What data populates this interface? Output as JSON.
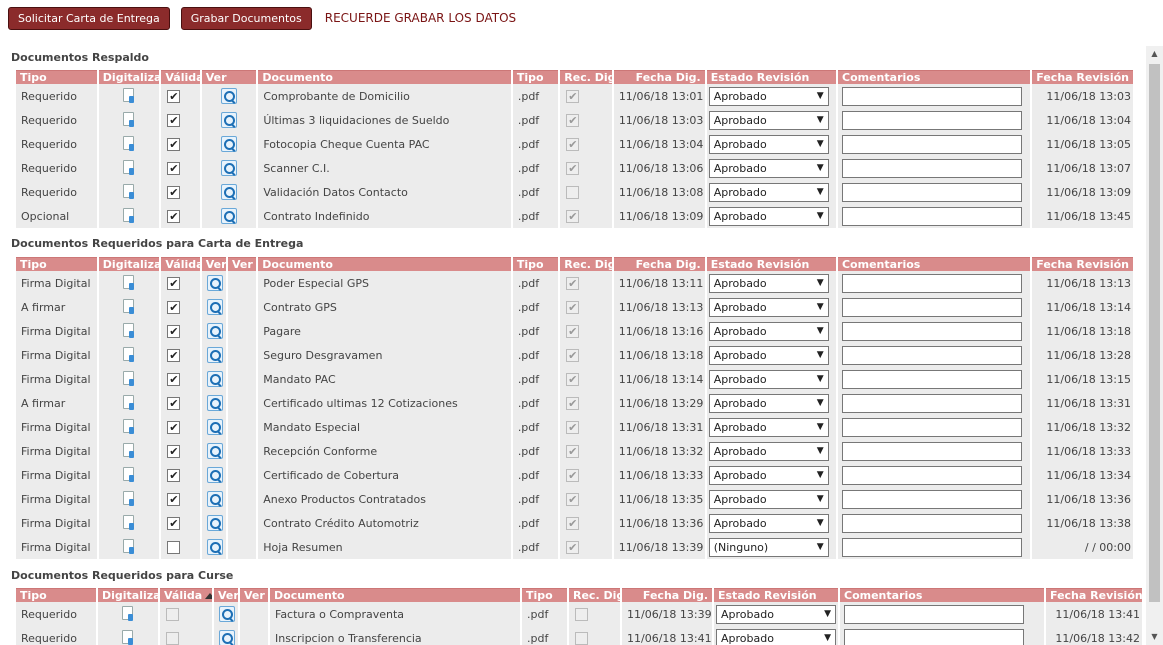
{
  "toolbar": {
    "btn_solicitar": "Solicitar Carta de Entrega",
    "btn_grabar": "Grabar Documentos",
    "notice": "RECUERDE GRABAR LOS DATOS"
  },
  "sections": [
    {
      "title": "Documentos Respaldo",
      "headers": {
        "tipo": "Tipo",
        "digitalizar": "Digitalizar",
        "valida": "Válida",
        "ver": "Ver",
        "documento": "Documento",
        "tipo2": "Tipo",
        "rec": "Rec. Dig.",
        "fecha": "Fecha Dig.",
        "estado": "Estado Revisión",
        "comentarios": "Comentarios",
        "fecha_rev": "Fecha Revisión"
      },
      "rows": [
        {
          "tipo": "Requerido",
          "documento": "Comprobante de Domicilio",
          "ext": ".pdf",
          "fecha": "11/06/18 13:01",
          "estado": "Aprobado",
          "fecha_rev": "11/06/18 13:03",
          "valida": true,
          "rec": true
        },
        {
          "tipo": "Requerido",
          "documento": "Últimas 3 liquidaciones de Sueldo",
          "ext": ".pdf",
          "fecha": "11/06/18 13:03",
          "estado": "Aprobado",
          "fecha_rev": "11/06/18 13:04",
          "valida": true,
          "rec": true
        },
        {
          "tipo": "Requerido",
          "documento": "Fotocopia Cheque Cuenta PAC",
          "ext": ".pdf",
          "fecha": "11/06/18 13:04",
          "estado": "Aprobado",
          "fecha_rev": "11/06/18 13:05",
          "valida": true,
          "rec": true
        },
        {
          "tipo": "Requerido",
          "documento": "Scanner C.I.",
          "ext": ".pdf",
          "fecha": "11/06/18 13:06",
          "estado": "Aprobado",
          "fecha_rev": "11/06/18 13:07",
          "valida": true,
          "rec": true
        },
        {
          "tipo": "Requerido",
          "documento": "Validación Datos Contacto",
          "ext": ".pdf",
          "fecha": "11/06/18 13:08",
          "estado": "Aprobado",
          "fecha_rev": "11/06/18 13:09",
          "valida": true,
          "rec": false
        },
        {
          "tipo": "Opcional",
          "documento": "Contrato Indefinido",
          "ext": ".pdf",
          "fecha": "11/06/18 13:09",
          "estado": "Aprobado",
          "fecha_rev": "11/06/18 13:45",
          "valida": true,
          "rec": true
        }
      ]
    },
    {
      "title": "Documentos Requeridos para Carta de Entrega",
      "headers": {
        "tipo": "Tipo",
        "digitalizar": "Digitalizar",
        "valida": "Válida",
        "ver": "Ver",
        "ver2": "Ver",
        "documento": "Documento",
        "tipo2": "Tipo",
        "rec": "Rec. Dig.",
        "fecha": "Fecha Dig.",
        "estado": "Estado Revisión",
        "comentarios": "Comentarios",
        "fecha_rev": "Fecha Revisión"
      },
      "rows": [
        {
          "tipo": "Firma Digital",
          "documento": "Poder Especial GPS",
          "ext": ".pdf",
          "fecha": "11/06/18 13:11",
          "estado": "Aprobado",
          "fecha_rev": "11/06/18 13:13",
          "valida": true,
          "rec": true
        },
        {
          "tipo": "A firmar",
          "documento": "Contrato GPS",
          "ext": ".pdf",
          "fecha": "11/06/18 13:13",
          "estado": "Aprobado",
          "fecha_rev": "11/06/18 13:14",
          "valida": true,
          "rec": true
        },
        {
          "tipo": "Firma Digital",
          "documento": "Pagare",
          "ext": ".pdf",
          "fecha": "11/06/18 13:16",
          "estado": "Aprobado",
          "fecha_rev": "11/06/18 13:18",
          "valida": true,
          "rec": true
        },
        {
          "tipo": "Firma Digital",
          "documento": "Seguro Desgravamen",
          "ext": ".pdf",
          "fecha": "11/06/18 13:18",
          "estado": "Aprobado",
          "fecha_rev": "11/06/18 13:28",
          "valida": true,
          "rec": true
        },
        {
          "tipo": "Firma Digital",
          "documento": "Mandato PAC",
          "ext": ".pdf",
          "fecha": "11/06/18 13:14",
          "estado": "Aprobado",
          "fecha_rev": "11/06/18 13:15",
          "valida": true,
          "rec": true
        },
        {
          "tipo": "A firmar",
          "documento": "Certificado ultimas 12 Cotizaciones",
          "ext": ".pdf",
          "fecha": "11/06/18 13:29",
          "estado": "Aprobado",
          "fecha_rev": "11/06/18 13:31",
          "valida": true,
          "rec": true
        },
        {
          "tipo": "Firma Digital",
          "documento": "Mandato Especial",
          "ext": ".pdf",
          "fecha": "11/06/18 13:31",
          "estado": "Aprobado",
          "fecha_rev": "11/06/18 13:32",
          "valida": true,
          "rec": true
        },
        {
          "tipo": "Firma Digital",
          "documento": "Recepción Conforme",
          "ext": ".pdf",
          "fecha": "11/06/18 13:32",
          "estado": "Aprobado",
          "fecha_rev": "11/06/18 13:33",
          "valida": true,
          "rec": true
        },
        {
          "tipo": "Firma Digital",
          "documento": "Certificado de Cobertura",
          "ext": ".pdf",
          "fecha": "11/06/18 13:33",
          "estado": "Aprobado",
          "fecha_rev": "11/06/18 13:34",
          "valida": true,
          "rec": true
        },
        {
          "tipo": "Firma Digital",
          "documento": "Anexo Productos Contratados",
          "ext": ".pdf",
          "fecha": "11/06/18 13:35",
          "estado": "Aprobado",
          "fecha_rev": "11/06/18 13:36",
          "valida": true,
          "rec": true
        },
        {
          "tipo": "Firma Digital",
          "documento": "Contrato Crédito Automotriz",
          "ext": ".pdf",
          "fecha": "11/06/18 13:36",
          "estado": "Aprobado",
          "fecha_rev": "11/06/18 13:38",
          "valida": true,
          "rec": true
        },
        {
          "tipo": "Firma Digital",
          "documento": "Hoja Resumen",
          "ext": ".pdf",
          "fecha": "11/06/18 13:39",
          "estado": "(Ninguno)",
          "fecha_rev": "/ / 00:00",
          "valida": false,
          "rec": true
        }
      ]
    },
    {
      "title": "Documentos Requeridos para Curse",
      "headers": {
        "tipo": "Tipo",
        "digitalizar": "Digitalizar",
        "valida": "Válida",
        "ver": "Ver",
        "ver2": "Ver",
        "documento": "Documento",
        "tipo2": "Tipo",
        "rec": "Rec. Dig.",
        "fecha": "Fecha Dig.",
        "estado": "Estado Revisión",
        "comentarios": "Comentarios",
        "fecha_rev": "Fecha Revisión"
      },
      "rows": [
        {
          "tipo": "Requerido",
          "documento": "Factura o Compraventa",
          "ext": ".pdf",
          "fecha": "11/06/18 13:39",
          "estado": "Aprobado",
          "fecha_rev": "11/06/18 13:41",
          "valida": false,
          "rec": false
        },
        {
          "tipo": "Requerido",
          "documento": "Inscripcion o Transferencia",
          "ext": ".pdf",
          "fecha": "11/06/18 13:41",
          "estado": "Aprobado",
          "fecha_rev": "11/06/18 13:42",
          "valida": false,
          "rec": false
        }
      ]
    }
  ],
  "icons": {
    "digitalizar": "document-upload-icon",
    "ver": "magnifier-icon",
    "check_mark": "✔",
    "dropdown_arrow": "▼",
    "sort": "sort-ascending-icon",
    "scroll_up": "▲",
    "scroll_down": "▼"
  },
  "colors": {
    "button_bg": "#8b2b2b",
    "notice": "#7a1414",
    "header_bg": "#d98b8b",
    "row_bg": "#ececec"
  }
}
